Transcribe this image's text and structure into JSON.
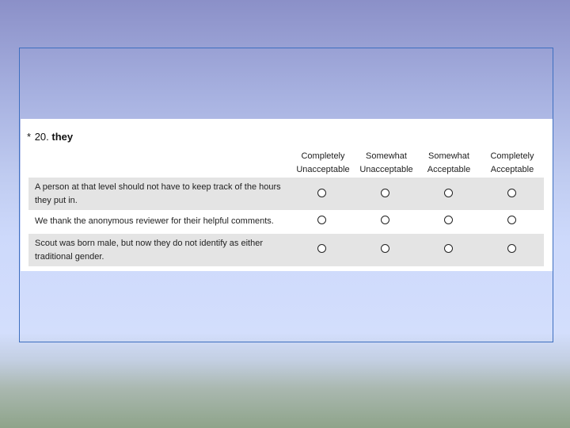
{
  "question": {
    "required_marker": "*",
    "number": "20.",
    "word": "they"
  },
  "columns": [
    {
      "line1": "Completely",
      "line2": "Unacceptable"
    },
    {
      "line1": "Somewhat",
      "line2": "Unacceptable"
    },
    {
      "line1": "Somewhat",
      "line2": "Acceptable"
    },
    {
      "line1": "Completely",
      "line2": "Acceptable"
    }
  ],
  "rows": [
    {
      "label": "A person at that level should not have to keep track of the hours they put in.",
      "selected": null
    },
    {
      "label": "We thank the anonymous reviewer for their helpful comments.",
      "selected": null
    },
    {
      "label": "Scout was born male, but now they do not identify as either traditional gender.",
      "selected": null
    }
  ]
}
